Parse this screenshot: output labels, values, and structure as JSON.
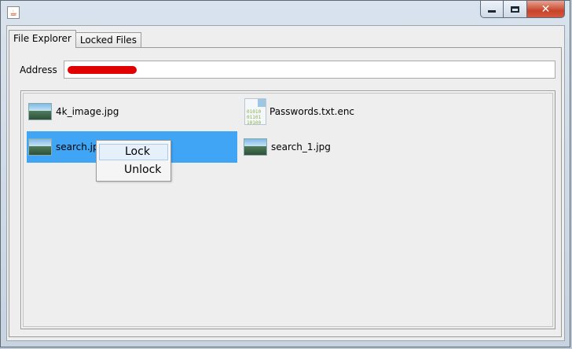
{
  "window": {
    "icon": "java-cup-icon",
    "controls": {
      "minimize": "minimize-icon",
      "maximize": "maximize-icon",
      "close": "close-icon"
    }
  },
  "tabs": [
    {
      "label": "File Explorer",
      "active": true
    },
    {
      "label": "Locked Files",
      "active": false
    }
  ],
  "address": {
    "label": "Address",
    "value_redacted": true
  },
  "files": [
    {
      "name": "4k_image.jpg",
      "icon": "image-icon",
      "selected": false
    },
    {
      "name": "Passwords.txt.enc",
      "icon": "encrypted-file-icon",
      "selected": false
    },
    {
      "name": "search.jpg",
      "icon": "image-icon",
      "selected": true
    },
    {
      "name": "search_1.jpg",
      "icon": "image-icon",
      "selected": false
    }
  ],
  "context_menu": {
    "items": [
      {
        "label": "Lock",
        "hovered": true
      },
      {
        "label": "Unlock",
        "hovered": false
      }
    ]
  },
  "colors": {
    "selection": "#41a5f5",
    "redaction": "#e00000"
  }
}
